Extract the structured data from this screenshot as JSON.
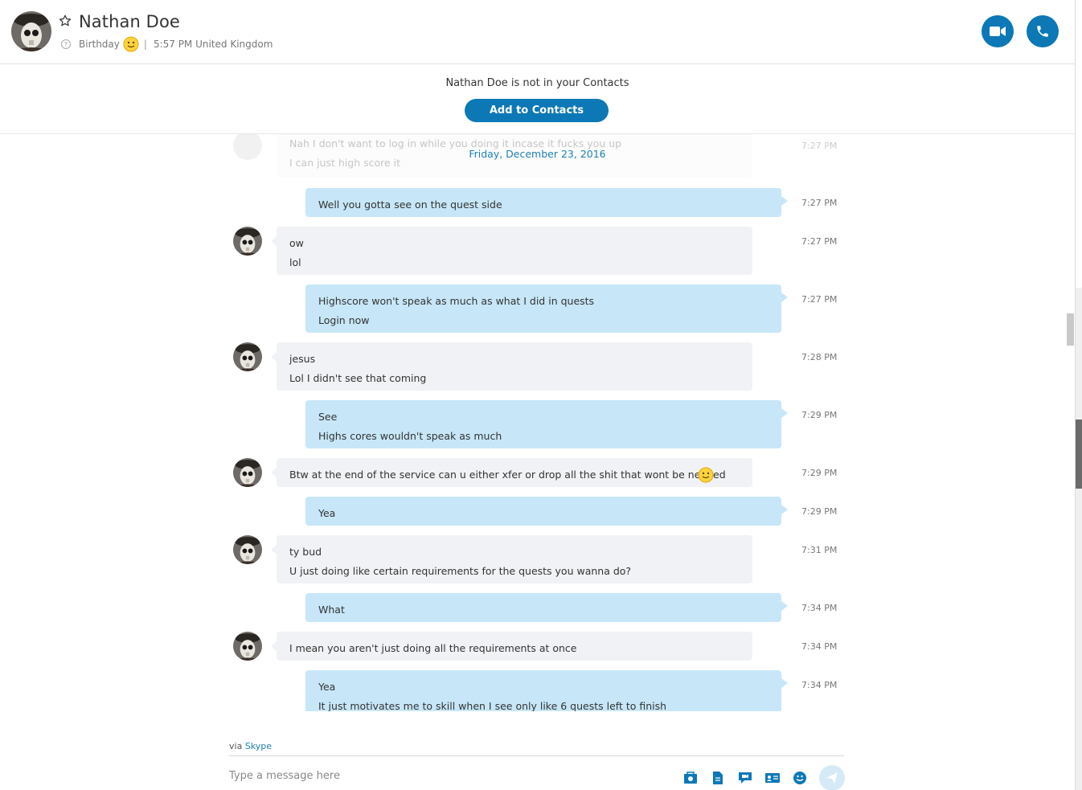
{
  "header": {
    "name": "Nathan Doe",
    "mood": "Birthday",
    "local_time": "5:57 PM United Kingdom"
  },
  "banner": {
    "text": "Nathan Doe is not in your Contacts",
    "button": "Add to Contacts"
  },
  "conversation": {
    "date": "Friday, December 23, 2016",
    "ghost": {
      "line1": "Nah I don't want to log in while you doing it incase it fucks you up",
      "line2": "I can just high score it",
      "time": "7:27 PM"
    },
    "messages": [
      {
        "dir": "out",
        "lines": [
          "Well you gotta see on the quest side"
        ],
        "time": "7:27 PM"
      },
      {
        "dir": "in",
        "lines": [
          "ow",
          "lol"
        ],
        "time": "7:27 PM"
      },
      {
        "dir": "out",
        "lines": [
          "Highscore won't speak as much as what I did in quests",
          "Login now"
        ],
        "time": "7:27 PM"
      },
      {
        "dir": "in",
        "lines": [
          "jesus",
          "Lol I didn't see that coming"
        ],
        "time": "7:28 PM"
      },
      {
        "dir": "out",
        "lines": [
          "See",
          "Highs cores wouldn't speak as much"
        ],
        "time": "7:29 PM"
      },
      {
        "dir": "in",
        "lines": [
          "Btw at the end of the service can u either xfer or drop all the shit that wont be needed"
        ],
        "time": "7:29 PM"
      },
      {
        "dir": "out",
        "lines": [
          "Yea"
        ],
        "time": "7:29 PM"
      },
      {
        "dir": "in",
        "lines": [
          "ty bud",
          "U just doing like certain requirements for the quests you wanna do?"
        ],
        "time": "7:31 PM"
      },
      {
        "dir": "out",
        "lines": [
          "What"
        ],
        "time": "7:34 PM"
      },
      {
        "dir": "in",
        "lines": [
          "I mean you aren't just doing all the requirements at once"
        ],
        "time": "7:34 PM"
      },
      {
        "dir": "out",
        "lines": [
          "Yea",
          "It just motivates me to skill when I see only like 6 quests left to finish"
        ],
        "time": "7:34 PM"
      }
    ]
  },
  "footer": {
    "via_prefix": "via",
    "via_link": "Skype",
    "placeholder": "Type a message here",
    "tools": [
      "media-gallery-icon",
      "send-file-icon",
      "video-message-icon",
      "contact-card-icon",
      "emoticon-icon",
      "send-icon"
    ]
  },
  "colors": {
    "accent": "#0c78b6",
    "outgoing_bubble": "#c7e7f8",
    "incoming_bubble": "#f1f2f5",
    "link": "#1c7fb5"
  }
}
